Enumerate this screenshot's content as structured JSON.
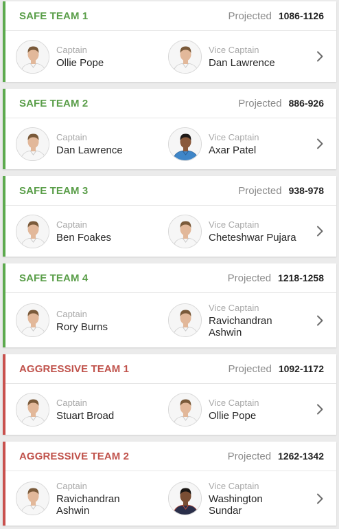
{
  "projected_label": "Projected",
  "colors": {
    "safe": "#5daa4e",
    "aggressive": "#c9514e"
  },
  "teams": [
    {
      "name": "SAFE TEAM 1",
      "kind": "safe",
      "projected": "1086-1126",
      "captain": {
        "role": "Captain",
        "name": "Ollie Pope",
        "kit": "white"
      },
      "vice": {
        "role": "Vice Captain",
        "name": "Dan Lawrence",
        "kit": "white"
      }
    },
    {
      "name": "SAFE TEAM 2",
      "kind": "safe",
      "projected": "886-926",
      "captain": {
        "role": "Captain",
        "name": "Dan Lawrence",
        "kit": "white"
      },
      "vice": {
        "role": "Vice Captain",
        "name": "Axar Patel",
        "kit": "blue"
      }
    },
    {
      "name": "SAFE TEAM 3",
      "kind": "safe",
      "projected": "938-978",
      "captain": {
        "role": "Captain",
        "name": "Ben Foakes",
        "kit": "white"
      },
      "vice": {
        "role": "Vice Captain",
        "name": "Cheteshwar Pujara",
        "kit": "white"
      }
    },
    {
      "name": "SAFE TEAM 4",
      "kind": "safe",
      "projected": "1218-1258",
      "captain": {
        "role": "Captain",
        "name": "Rory Burns",
        "kit": "white"
      },
      "vice": {
        "role": "Vice Captain",
        "name_line1": "Ravichandran",
        "name_line2": "Ashwin",
        "kit": "white"
      }
    },
    {
      "name": "AGGRESSIVE TEAM 1",
      "kind": "aggressive",
      "projected": "1092-1172",
      "captain": {
        "role": "Captain",
        "name": "Stuart Broad",
        "kit": "white"
      },
      "vice": {
        "role": "Vice Captain",
        "name": "Ollie Pope",
        "kit": "white"
      }
    },
    {
      "name": "AGGRESSIVE TEAM 2",
      "kind": "aggressive",
      "projected": "1262-1342",
      "captain": {
        "role": "Captain",
        "name_line1": "Ravichandran",
        "name_line2": "Ashwin",
        "kit": "white"
      },
      "vice": {
        "role": "Vice Captain",
        "name_line1": "Washington",
        "name_line2": "Sundar",
        "kit": "dark"
      }
    }
  ],
  "icons": {
    "avatar": "player-avatar-icon",
    "chevron": "chevron-right-icon"
  }
}
